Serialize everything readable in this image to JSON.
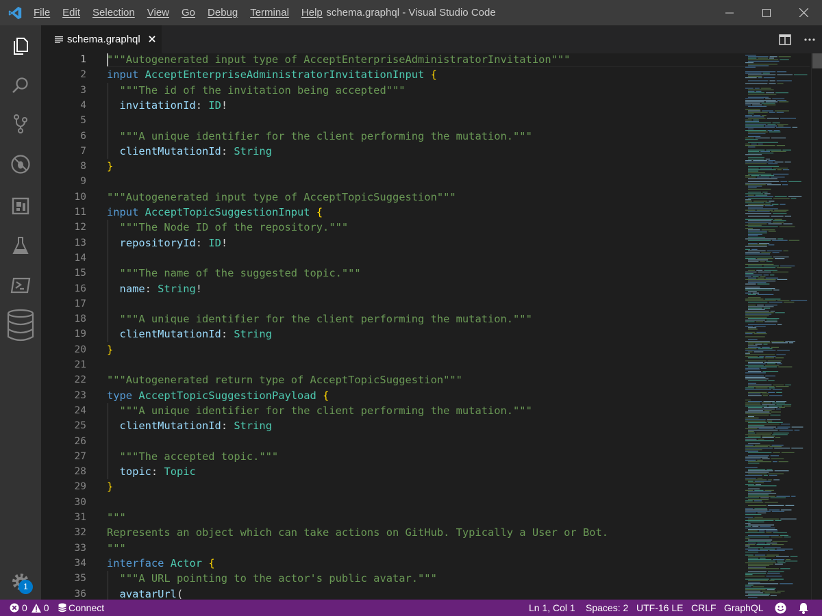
{
  "titlebar": {
    "window_title": "schema.graphql - Visual Studio Code",
    "menu": [
      "File",
      "Edit",
      "Selection",
      "View",
      "Go",
      "Debug",
      "Terminal",
      "Help"
    ]
  },
  "activity_bar": {
    "icons": [
      "explorer-icon",
      "search-icon",
      "source-control-icon",
      "debug-icon",
      "extensions-icon",
      "test-flask-icon",
      "terminal-icon",
      "database-icon"
    ],
    "settings_badge": "1"
  },
  "tabs": [
    {
      "label": "schema.graphql",
      "active": true
    }
  ],
  "editor": {
    "cursor_line": 1,
    "lines": [
      [
        [
          "com",
          "\"\"\"Autogenerated input type of AcceptEnterpriseAdministratorInvitation\"\"\""
        ]
      ],
      [
        [
          "kw",
          "input"
        ],
        [
          "punc",
          " "
        ],
        [
          "type",
          "AcceptEnterpriseAdministratorInvitationInput"
        ],
        [
          "punc",
          " "
        ],
        [
          "brace",
          "{"
        ]
      ],
      [
        [
          "punc",
          "  "
        ],
        [
          "com",
          "\"\"\"The id of the invitation being accepted\"\"\""
        ]
      ],
      [
        [
          "punc",
          "  "
        ],
        [
          "field",
          "invitationId"
        ],
        [
          "punc",
          ": "
        ],
        [
          "type",
          "ID"
        ],
        [
          "punc",
          "!"
        ]
      ],
      [],
      [
        [
          "punc",
          "  "
        ],
        [
          "com",
          "\"\"\"A unique identifier for the client performing the mutation.\"\"\""
        ]
      ],
      [
        [
          "punc",
          "  "
        ],
        [
          "field",
          "clientMutationId"
        ],
        [
          "punc",
          ": "
        ],
        [
          "type",
          "String"
        ]
      ],
      [
        [
          "brace",
          "}"
        ]
      ],
      [],
      [
        [
          "com",
          "\"\"\"Autogenerated input type of AcceptTopicSuggestion\"\"\""
        ]
      ],
      [
        [
          "kw",
          "input"
        ],
        [
          "punc",
          " "
        ],
        [
          "type",
          "AcceptTopicSuggestionInput"
        ],
        [
          "punc",
          " "
        ],
        [
          "brace",
          "{"
        ]
      ],
      [
        [
          "punc",
          "  "
        ],
        [
          "com",
          "\"\"\"The Node ID of the repository.\"\"\""
        ]
      ],
      [
        [
          "punc",
          "  "
        ],
        [
          "field",
          "repositoryId"
        ],
        [
          "punc",
          ": "
        ],
        [
          "type",
          "ID"
        ],
        [
          "punc",
          "!"
        ]
      ],
      [],
      [
        [
          "punc",
          "  "
        ],
        [
          "com",
          "\"\"\"The name of the suggested topic.\"\"\""
        ]
      ],
      [
        [
          "punc",
          "  "
        ],
        [
          "field",
          "name"
        ],
        [
          "punc",
          ": "
        ],
        [
          "type",
          "String"
        ],
        [
          "punc",
          "!"
        ]
      ],
      [],
      [
        [
          "punc",
          "  "
        ],
        [
          "com",
          "\"\"\"A unique identifier for the client performing the mutation.\"\"\""
        ]
      ],
      [
        [
          "punc",
          "  "
        ],
        [
          "field",
          "clientMutationId"
        ],
        [
          "punc",
          ": "
        ],
        [
          "type",
          "String"
        ]
      ],
      [
        [
          "brace",
          "}"
        ]
      ],
      [],
      [
        [
          "com",
          "\"\"\"Autogenerated return type of AcceptTopicSuggestion\"\"\""
        ]
      ],
      [
        [
          "kw",
          "type"
        ],
        [
          "punc",
          " "
        ],
        [
          "type",
          "AcceptTopicSuggestionPayload"
        ],
        [
          "punc",
          " "
        ],
        [
          "brace",
          "{"
        ]
      ],
      [
        [
          "punc",
          "  "
        ],
        [
          "com",
          "\"\"\"A unique identifier for the client performing the mutation.\"\"\""
        ]
      ],
      [
        [
          "punc",
          "  "
        ],
        [
          "field",
          "clientMutationId"
        ],
        [
          "punc",
          ": "
        ],
        [
          "type",
          "String"
        ]
      ],
      [],
      [
        [
          "punc",
          "  "
        ],
        [
          "com",
          "\"\"\"The accepted topic.\"\"\""
        ]
      ],
      [
        [
          "punc",
          "  "
        ],
        [
          "field",
          "topic"
        ],
        [
          "punc",
          ": "
        ],
        [
          "type",
          "Topic"
        ]
      ],
      [
        [
          "brace",
          "}"
        ]
      ],
      [],
      [
        [
          "com",
          "\"\"\""
        ]
      ],
      [
        [
          "com",
          "Represents an object which can take actions on GitHub. Typically a User or Bot."
        ]
      ],
      [
        [
          "com",
          "\"\"\""
        ]
      ],
      [
        [
          "kw",
          "interface"
        ],
        [
          "punc",
          " "
        ],
        [
          "type",
          "Actor"
        ],
        [
          "punc",
          " "
        ],
        [
          "brace",
          "{"
        ]
      ],
      [
        [
          "punc",
          "  "
        ],
        [
          "com",
          "\"\"\"A URL pointing to the actor's public avatar.\"\"\""
        ]
      ],
      [
        [
          "punc",
          "  "
        ],
        [
          "field",
          "avatarUrl"
        ],
        [
          "brace2",
          "("
        ]
      ]
    ]
  },
  "statusbar": {
    "errors": "0",
    "warnings": "0",
    "connect": "Connect",
    "position": "Ln 1, Col 1",
    "spaces": "Spaces: 2",
    "encoding": "UTF-16 LE",
    "eol": "CRLF",
    "language": "GraphQL"
  },
  "colors": {
    "statusbar": "#68217a",
    "comment": "#6a9955",
    "keyword": "#569cd6",
    "type": "#4ec9b0",
    "field": "#9cdcfe"
  }
}
